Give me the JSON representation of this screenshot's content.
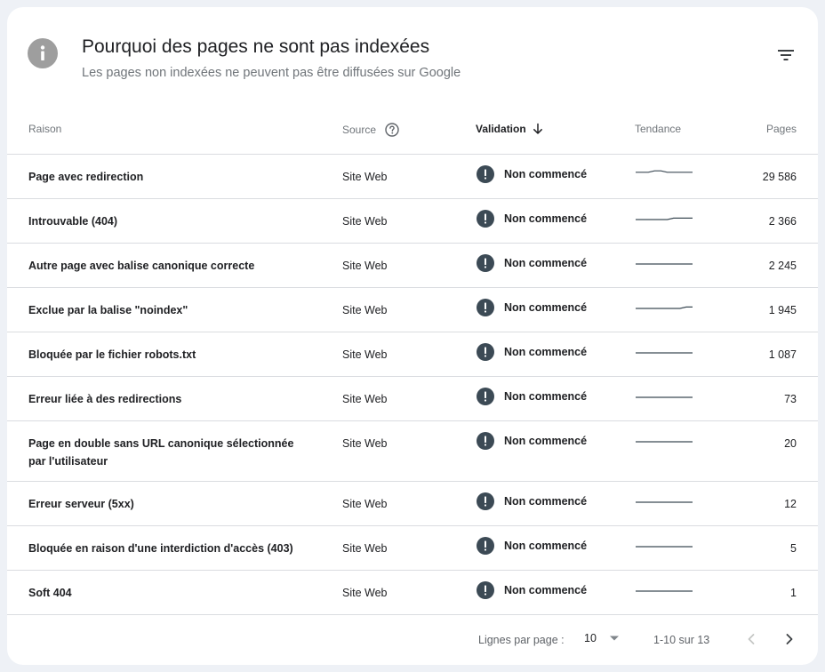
{
  "header": {
    "title": "Pourquoi des pages ne sont pas indexées",
    "subtitle": "Les pages non indexées ne peuvent pas être diffusées sur Google",
    "info_icon": "info-icon",
    "filter_icon": "filter-icon"
  },
  "columns": {
    "raison": "Raison",
    "source": "Source",
    "validation": "Validation",
    "tendance": "Tendance",
    "pages": "Pages"
  },
  "colors": {
    "status_icon": "#3c4a55",
    "trend_line": "#3c4a55",
    "info_icon_bg": "#9e9e9e"
  },
  "rows": [
    {
      "raison": "Page avec redirection",
      "source": "Site Web",
      "validation": "Non commencé",
      "pages": "29 586",
      "trend": [
        2,
        2,
        2,
        3,
        3,
        2,
        2,
        2,
        2,
        2
      ]
    },
    {
      "raison": "Introuvable (404)",
      "source": "Site Web",
      "validation": "Non commencé",
      "pages": "2 366",
      "trend": [
        0,
        0,
        0,
        0,
        0,
        0,
        1,
        1,
        1,
        1
      ]
    },
    {
      "raison": "Autre page avec balise canonique correcte",
      "source": "Site Web",
      "validation": "Non commencé",
      "pages": "2 245",
      "trend": [
        0,
        0,
        0,
        0,
        0,
        0,
        0,
        0,
        0,
        0
      ]
    },
    {
      "raison": "Exclue par la balise \"noindex\"",
      "source": "Site Web",
      "validation": "Non commencé",
      "pages": "1 945",
      "trend": [
        0,
        0,
        0,
        0,
        0,
        0,
        0,
        0,
        1,
        1
      ]
    },
    {
      "raison": "Bloquée par le fichier robots.txt",
      "source": "Site Web",
      "validation": "Non commencé",
      "pages": "1 087",
      "trend": [
        0,
        0,
        0,
        0,
        0,
        0,
        0,
        0,
        0,
        0
      ]
    },
    {
      "raison": "Erreur liée à des redirections",
      "source": "Site Web",
      "validation": "Non commencé",
      "pages": "73",
      "trend": [
        0,
        0,
        0,
        0,
        0,
        0,
        0,
        0,
        0,
        0
      ]
    },
    {
      "raison": "Page en double sans URL canonique sélectionnée par l'utilisateur",
      "source": "Site Web",
      "validation": "Non commencé",
      "pages": "20",
      "trend": [
        0,
        0,
        0,
        0,
        0,
        0,
        0,
        0,
        0,
        0
      ]
    },
    {
      "raison": "Erreur serveur (5xx)",
      "source": "Site Web",
      "validation": "Non commencé",
      "pages": "12",
      "trend": [
        0,
        0,
        0,
        0,
        0,
        0,
        0,
        0,
        0,
        0
      ]
    },
    {
      "raison": "Bloquée en raison d'une interdiction d'accès (403)",
      "source": "Site Web",
      "validation": "Non commencé",
      "pages": "5",
      "trend": [
        0,
        0,
        0,
        0,
        0,
        0,
        0,
        0,
        0,
        0
      ]
    },
    {
      "raison": "Soft 404",
      "source": "Site Web",
      "validation": "Non commencé",
      "pages": "1",
      "trend": [
        0,
        0,
        0,
        0,
        0,
        0,
        0,
        0,
        0,
        0
      ]
    }
  ],
  "footer": {
    "rows_per_page_label": "Lignes par page :",
    "rows_per_page_value": "10",
    "range_text": "1-10 sur 13"
  }
}
